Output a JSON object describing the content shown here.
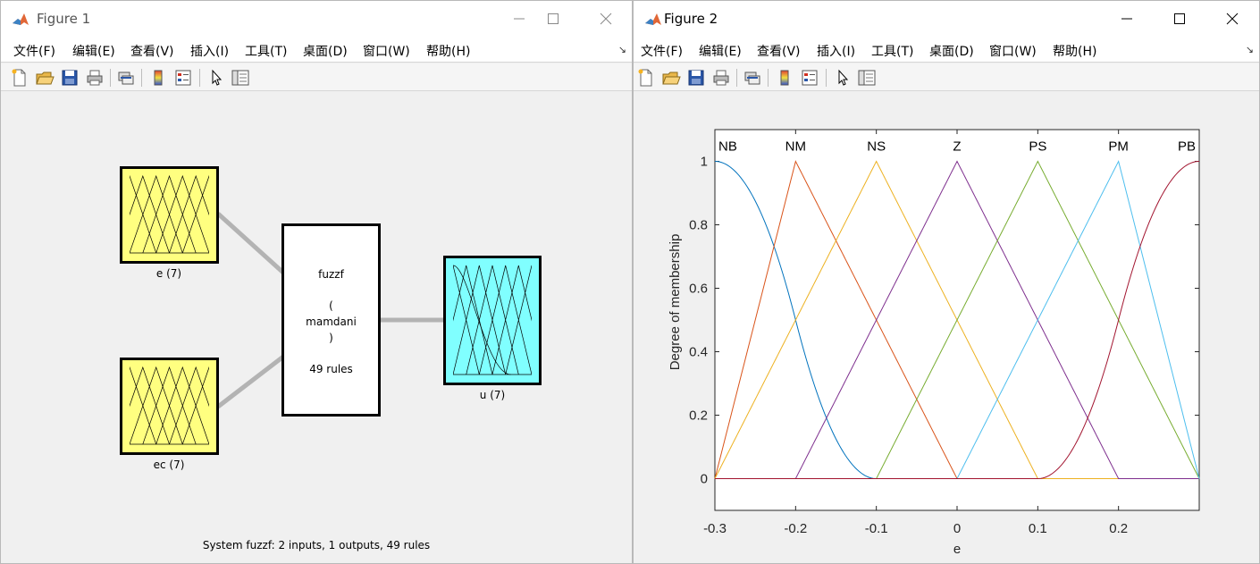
{
  "figure1": {
    "title": "Figure 1",
    "status": "System fuzzf: 2 inputs, 1 outputs, 49 rules",
    "inputs": [
      {
        "label": "e (7)"
      },
      {
        "label": "ec (7)"
      }
    ],
    "output": {
      "label": "u (7)"
    },
    "rule_block": {
      "name": "fuzzf",
      "paren_open": "(",
      "method": "mamdani",
      "paren_close": ")",
      "rules": "49 rules"
    },
    "colors": {
      "input_fill": "#ffff80",
      "output_fill": "#80ffff",
      "connector": "#b3b3b3"
    }
  },
  "figure2": {
    "title": "Figure 2"
  },
  "menu": [
    "文件(F)",
    "编辑(E)",
    "查看(V)",
    "插入(I)",
    "工具(T)",
    "桌面(D)",
    "窗口(W)",
    "帮助(H)"
  ],
  "toolbar_icons": [
    "new-file-icon",
    "open-folder-icon",
    "save-icon",
    "print-icon",
    "link-plot-icon",
    "colorbar-icon",
    "legend-icon",
    "pointer-icon",
    "property-inspector-icon"
  ],
  "chart_data": {
    "type": "line",
    "xlabel": "e",
    "ylabel": "Degree of membership",
    "xlim": [
      -0.3,
      0.3
    ],
    "ylim": [
      -0.1,
      1.1
    ],
    "xticks": [
      -0.3,
      -0.2,
      -0.1,
      0,
      0.1,
      0.2
    ],
    "xtick_labels": [
      "-0.3",
      "-0.2",
      "-0.1",
      "0",
      "0.1",
      "0.2"
    ],
    "yticks": [
      0,
      0.2,
      0.4,
      0.6,
      0.8,
      1
    ],
    "ytick_labels": [
      "0",
      "0.2",
      "0.4",
      "0.6",
      "0.8",
      "1"
    ],
    "grid": false,
    "series": [
      {
        "name": "NB",
        "color": "#0072bd",
        "shape": "zmf",
        "params": [
          -0.3,
          -0.1
        ],
        "x": [
          -0.3,
          -0.1
        ]
      },
      {
        "name": "NM",
        "color": "#d95319",
        "shape": "trimf",
        "x": [
          -0.3,
          -0.2,
          0
        ],
        "y": [
          0,
          1,
          0
        ]
      },
      {
        "name": "NS",
        "color": "#edb120",
        "shape": "trimf",
        "x": [
          -0.3,
          -0.1,
          0.1
        ],
        "y": [
          0,
          1,
          0
        ]
      },
      {
        "name": "Z",
        "color": "#7e2f8e",
        "shape": "trimf",
        "x": [
          -0.2,
          0,
          0.2
        ],
        "y": [
          0,
          1,
          0
        ]
      },
      {
        "name": "PS",
        "color": "#77ac30",
        "shape": "trimf",
        "x": [
          -0.1,
          0.1,
          0.3
        ],
        "y": [
          0,
          1,
          0
        ]
      },
      {
        "name": "PM",
        "color": "#4dbeee",
        "shape": "trimf",
        "x": [
          0,
          0.2,
          0.3
        ],
        "y": [
          0,
          1,
          0
        ]
      },
      {
        "name": "PB",
        "color": "#a2142f",
        "shape": "smf",
        "params": [
          0.1,
          0.3
        ],
        "x": [
          0.1,
          0.3
        ]
      }
    ]
  }
}
